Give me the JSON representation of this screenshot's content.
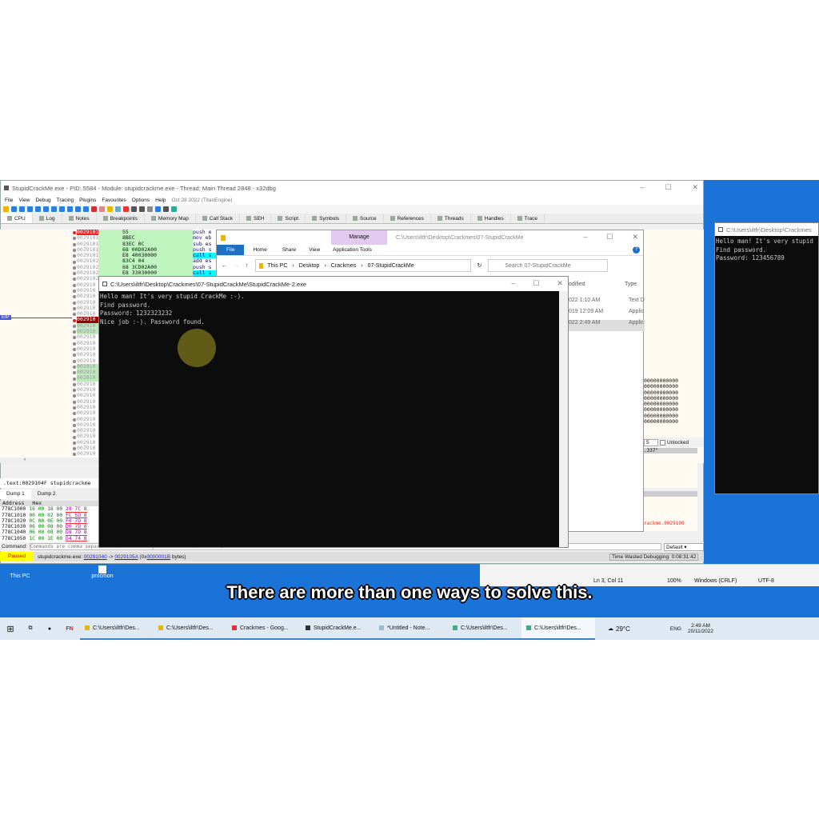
{
  "debugger": {
    "title": "StupidCrackMe.exe - PID: 5584 - Module: stupidcrackme.exe - Thread: Main Thread 2848 - x32dbg",
    "menu": [
      "File",
      "View",
      "Debug",
      "Tracing",
      "Plugins",
      "Favourites",
      "Options",
      "Help",
      "Oct 28 2022 (TitanEngine)"
    ],
    "tabs": [
      "CPU",
      "Log",
      "Notes",
      "Breakpoints",
      "Memory Map",
      "Call Stack",
      "SEH",
      "Script",
      "Symbols",
      "Source",
      "References",
      "Threads",
      "Handles",
      "Trace"
    ],
    "eip_label": "EIP",
    "disasm": [
      {
        "addr": "00291010",
        "bytes": "55",
        "instr": "push e"
      },
      {
        "addr": "00291011",
        "bytes": "8BEC",
        "instr": "mov eb"
      },
      {
        "addr": "00291013",
        "bytes": "83EC 0C",
        "instr": "sub es"
      },
      {
        "addr": "00291016",
        "bytes": "68 00D02A00",
        "instr": "push s"
      },
      {
        "addr": "00291018",
        "bytes": "E8 40030000",
        "instr": "call s"
      },
      {
        "addr": "00291020",
        "bytes": "83C4 04",
        "instr": "add es"
      },
      {
        "addr": "00291023",
        "bytes": "68 3CD02A00",
        "instr": "push s"
      },
      {
        "addr": "00291028",
        "bytes": "E8 33030000",
        "instr": "call s"
      },
      {
        "addr": "0029102D",
        "bytes": "83C4 04",
        "instr": "add e"
      }
    ],
    "addr_stub": "002910",
    "info_line": ".text:0029104F stupidcrackme",
    "dump_tabs": [
      "Dump 1",
      "Dump 2"
    ],
    "dump_headers": [
      "Address",
      "Hex"
    ],
    "dump_rows": [
      {
        "addr": "778C1000",
        "hex": "16 00 18 00",
        "hex2": "28 7C 8"
      },
      {
        "addr": "778C1010",
        "hex": "00 00 02 00",
        "hex2": "FC 5D 8"
      },
      {
        "addr": "778C1020",
        "hex": "0C 00 0E 00",
        "hex2": "F0 7D 8"
      },
      {
        "addr": "778C1030",
        "hex": "06 00 08 00",
        "hex2": "D0 7D 8"
      },
      {
        "addr": "778C1040",
        "hex": "06 00 08 00",
        "hex2": "D8 7D 8"
      },
      {
        "addr": "778C1050",
        "hex": "1C 00 1E 00",
        "hex2": "D4 74 8"
      }
    ],
    "command_label": "Command:",
    "command_placeholder": "Commands are comma separated (like assembly instructions): mov eax, ebx",
    "status": "Paused",
    "status_text": "stupidcrackme.exe: ",
    "status_from": "00291040",
    "status_arrow": " -> ",
    "status_to": "0029105A",
    "status_size_pre": " (0x",
    "status_size": "0000001B",
    "status_size_post": " bytes)",
    "time_wasted": "Time Wasted Debugging: 0:08:31:42",
    "stack_value": "5",
    "unlocked_label": "Unlocked",
    "str_337": ".337\"",
    "default_select": "Default",
    "ref_text": "rackme.0029100",
    "zeros": "00000000000"
  },
  "explorer": {
    "manage": "Manage",
    "app_tools": "Application Tools",
    "path_title": "C:\\Users\\iltfr\\Desktop\\Crackmes\\07-StupidCrackMe",
    "ribbon": [
      "File",
      "Home",
      "Share",
      "View"
    ],
    "breadcrumb": [
      "This PC",
      "Desktop",
      "Crackmes",
      "07-StupidCrackMe"
    ],
    "search_placeholder": "Search 07-StupidCrackMe",
    "col_modified": "odified",
    "col_type": "Type",
    "rows": [
      {
        "date": "022 1:10 AM",
        "type": "Text D"
      },
      {
        "date": "019 12:09 AM",
        "type": "Applic"
      },
      {
        "date": "022 2:49 AM",
        "type": "Applic"
      }
    ]
  },
  "console": {
    "title": "C:\\Users\\iltfr\\Desktop\\Crackmes\\07-StupidCrackMe\\StupidCrackMe-2.exe",
    "lines": "Hello man! It's very stupid CrackMe :-).\nFind password.\nPassword: 1232323232\nNice job :-). Password found."
  },
  "console2": {
    "title": "C:\\Users\\iltfr\\Desktop\\Crackmes",
    "lines": "Hello man! It's very stupid\nFind password.\nPassword: 123456789"
  },
  "notepad": {
    "pos": "Ln 3, Col 11",
    "zoom": "100%",
    "eol": "Windows (CRLF)",
    "enc": "UTF-8"
  },
  "desktop_icons": [
    "This PC",
    "procmon"
  ],
  "subtitle": "There are more than one ways to solve this.",
  "taskbar": {
    "items": [
      "C:\\Users\\iltfr\\Des...",
      "C:\\Users\\iltfr\\Des...",
      "Crackmes - Goog...",
      "StupidCrackMe.e...",
      "*Untitled - Note...",
      "C:\\Users\\iltfr\\Des...",
      "C:\\Users\\iltfr\\Des..."
    ],
    "weather": "29°C",
    "lang": "ENG",
    "time": "2:49 AM",
    "date": "20/11/2022"
  }
}
